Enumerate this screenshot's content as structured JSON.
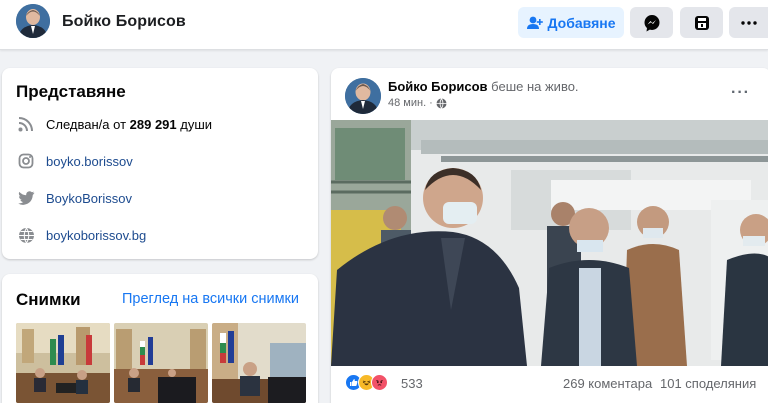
{
  "header": {
    "name": "Бойко Борисов",
    "add_label": "Добавяне",
    "messenger_icon": "messenger-icon",
    "save_icon": "save-icon",
    "more_icon": "more-icon"
  },
  "intro": {
    "title": "Представяне",
    "followers_prefix": "Следван/а от ",
    "followers_count": "289 291",
    "followers_suffix": " души",
    "instagram": "boyko.borissov",
    "twitter": "BoykoBorissov",
    "website": "boykoborissov.bg"
  },
  "photos": {
    "title": "Снимки",
    "see_all": "Преглед на всички снимки"
  },
  "post": {
    "author": "Бойко Борисов",
    "action": " беше на живо.",
    "time": "48 мин. ·",
    "more": "···",
    "reactions_count": "533",
    "comments": "269 коментара",
    "shares": "101 споделяния",
    "reaction_colors": [
      "#1877f2",
      "#f7b928",
      "#f25268"
    ]
  }
}
